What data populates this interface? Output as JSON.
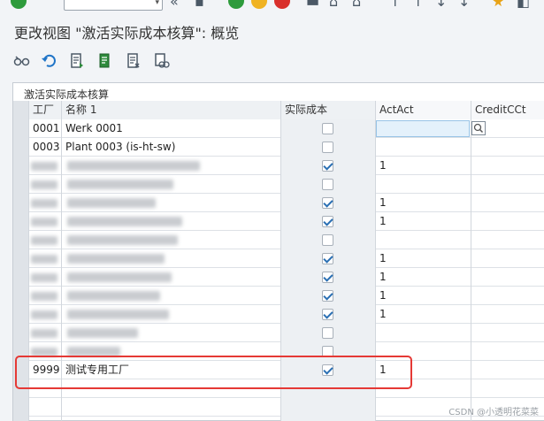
{
  "window": {
    "title": "更改视图 \"激活实际成本核算\": 概览"
  },
  "panel": {
    "title": "激活实际成本核算"
  },
  "table": {
    "columns": [
      "工厂",
      "名称 1",
      "实际成本",
      "ActAct",
      "CreditCCt"
    ],
    "rows": [
      {
        "plant": "0001",
        "name": "Werk 0001",
        "checked": false,
        "actact": ""
      },
      {
        "plant": "0003",
        "name": "Plant 0003 (is-ht-sw)",
        "checked": false,
        "actact": ""
      },
      {
        "plant": "",
        "name": "",
        "checked": true,
        "actact": "1",
        "blurred": true
      },
      {
        "plant": "",
        "name": "",
        "checked": false,
        "actact": "",
        "blurred": true
      },
      {
        "plant": "",
        "name": "",
        "checked": true,
        "actact": "1",
        "blurred": true
      },
      {
        "plant": "",
        "name": "",
        "checked": true,
        "actact": "1",
        "blurred": true
      },
      {
        "plant": "",
        "name": "",
        "checked": false,
        "actact": "",
        "blurred": true
      },
      {
        "plant": "",
        "name": "",
        "checked": true,
        "actact": "1",
        "blurred": true
      },
      {
        "plant": "",
        "name": "",
        "checked": true,
        "actact": "1",
        "blurred": true
      },
      {
        "plant": "",
        "name": "",
        "checked": true,
        "actact": "1",
        "blurred": true
      },
      {
        "plant": "",
        "name": "",
        "checked": true,
        "actact": "1",
        "blurred": true
      },
      {
        "plant": "",
        "name": "",
        "checked": false,
        "actact": "",
        "blurred": true
      },
      {
        "plant": "",
        "name": "",
        "checked": false,
        "actact": "",
        "blurred": true
      },
      {
        "plant": "9999",
        "name": "测试专用工厂",
        "checked": true,
        "actact": "1"
      }
    ]
  },
  "watermark": "CSDN @小透明花菜菜",
  "colors": {
    "highlight_box": "#e53935",
    "checkbox_mark": "#2a6fb3"
  }
}
